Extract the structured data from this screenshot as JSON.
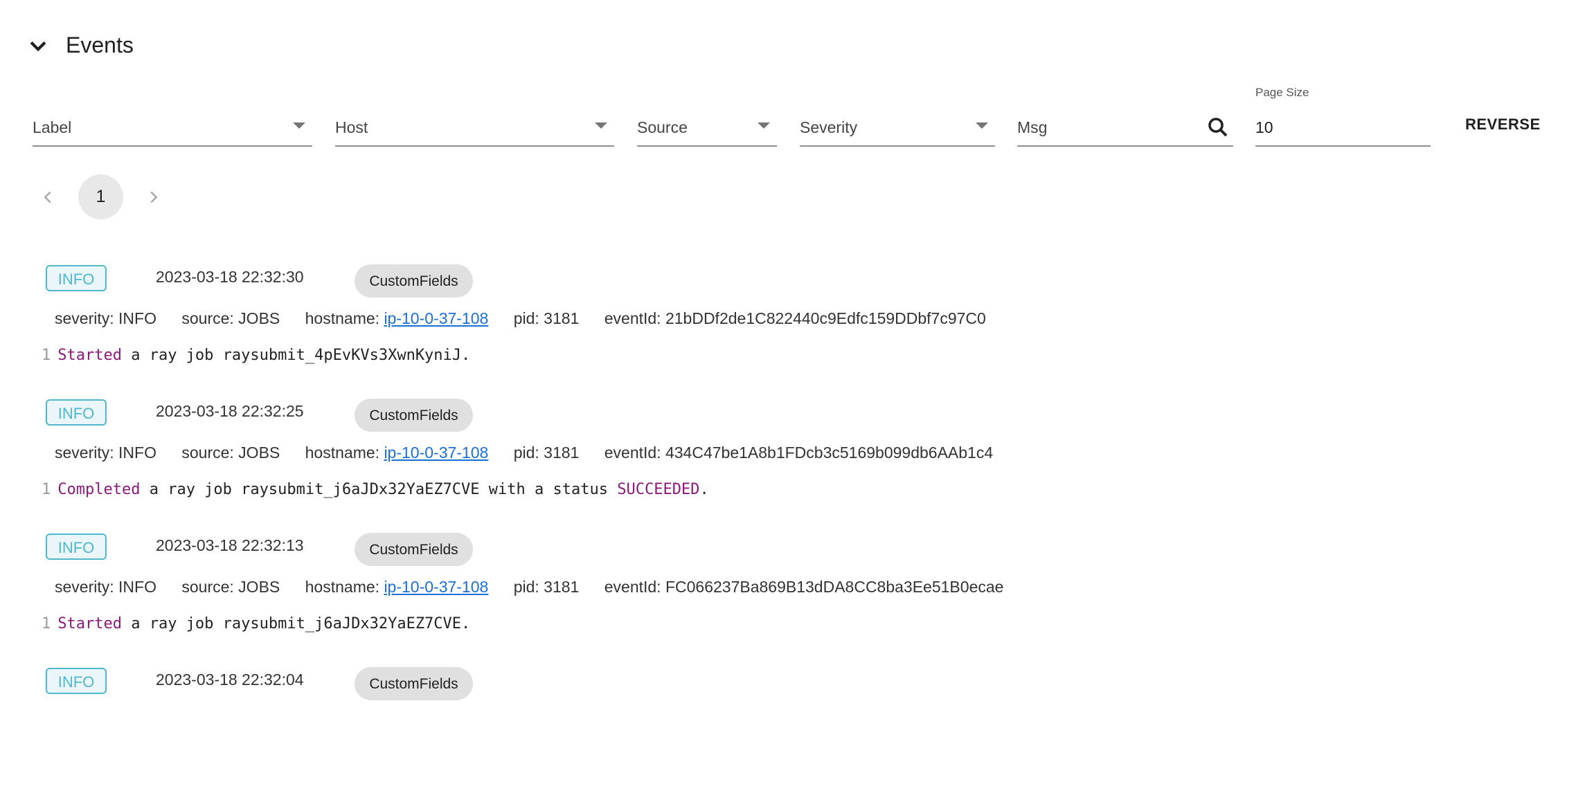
{
  "section": {
    "title": "Events",
    "collapse_icon": "chevron-down-icon"
  },
  "filters": {
    "label": {
      "placeholder": "Label"
    },
    "host": {
      "placeholder": "Host"
    },
    "source": {
      "placeholder": "Source"
    },
    "severity": {
      "placeholder": "Severity"
    },
    "msg": {
      "placeholder": "Msg",
      "icon": "search-icon"
    },
    "page_size": {
      "label": "Page Size",
      "value": "10"
    },
    "reverse_label": "REVERSE"
  },
  "pagination": {
    "current_page": "1",
    "prev_icon": "chevron-left-icon",
    "next_icon": "chevron-right-icon"
  },
  "colors": {
    "info_badge": "#4fb8cc",
    "link": "#1a6fd6",
    "keyword": "#8b1a7a"
  },
  "events": [
    {
      "severity_badge": "INFO",
      "time": "2023-03-18 22:32:30",
      "chip": "CustomFields",
      "severity": "severity: INFO",
      "source": "source: JOBS",
      "hostname_label": "hostname: ",
      "hostname": "ip-10-0-37-108",
      "pid": "pid: 3181",
      "event_id": "eventId: 21bDDf2de1C822440c9Edfc159DDbf7c97C0",
      "line_no": "1",
      "msg_kw1": "Started",
      "msg_mid": " a ray job raysubmit_4pEvKVs3XwnKyniJ.",
      "msg_kw2": "",
      "msg_end": ""
    },
    {
      "severity_badge": "INFO",
      "time": "2023-03-18 22:32:25",
      "chip": "CustomFields",
      "severity": "severity: INFO",
      "source": "source: JOBS",
      "hostname_label": "hostname: ",
      "hostname": "ip-10-0-37-108",
      "pid": "pid: 3181",
      "event_id": "eventId: 434C47be1A8b1FDcb3c5169b099db6AAb1c4",
      "line_no": "1",
      "msg_kw1": "Completed",
      "msg_mid": " a ray job raysubmit_j6aJDx32YaEZ7CVE with a status ",
      "msg_kw2": "SUCCEEDED",
      "msg_end": "."
    },
    {
      "severity_badge": "INFO",
      "time": "2023-03-18 22:32:13",
      "chip": "CustomFields",
      "severity": "severity: INFO",
      "source": "source: JOBS",
      "hostname_label": "hostname: ",
      "hostname": "ip-10-0-37-108",
      "pid": "pid: 3181",
      "event_id": "eventId: FC066237Ba869B13dDA8CC8ba3Ee51B0ecae",
      "line_no": "1",
      "msg_kw1": "Started",
      "msg_mid": " a ray job raysubmit_j6aJDx32YaEZ7CVE.",
      "msg_kw2": "",
      "msg_end": ""
    },
    {
      "severity_badge": "INFO",
      "time": "2023-03-18 22:32:04",
      "chip": "CustomFields"
    }
  ]
}
